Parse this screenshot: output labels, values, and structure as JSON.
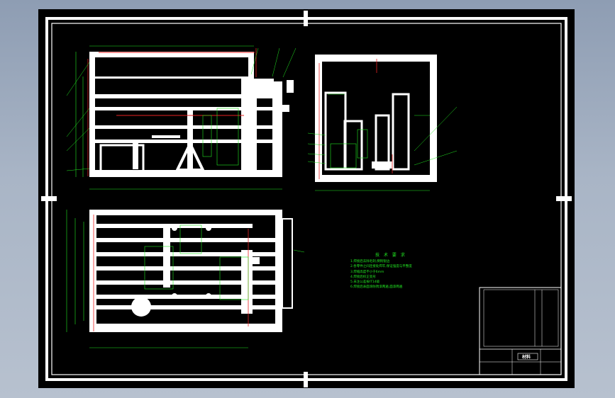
{
  "technical_requirements": {
    "title": "技 术 要 求",
    "items": [
      "1.焊接后去除毛刺,倒钝锐边",
      "2.各零件之间连接处焊牢,保证强度与平整度",
      "3.焊缝高度不小于6mm",
      "4.焊接后校正变形",
      "5.未注公差按IT14级",
      "6.焊接后表面涂防锈漆两遍,面漆两遍"
    ]
  },
  "title_block": {
    "material_label": "材料"
  },
  "colors": {
    "background": "#000000",
    "part": "#ffffff",
    "dimension": "#22e822",
    "centerline": "#e82222",
    "workspace": "#a9b5c6"
  }
}
